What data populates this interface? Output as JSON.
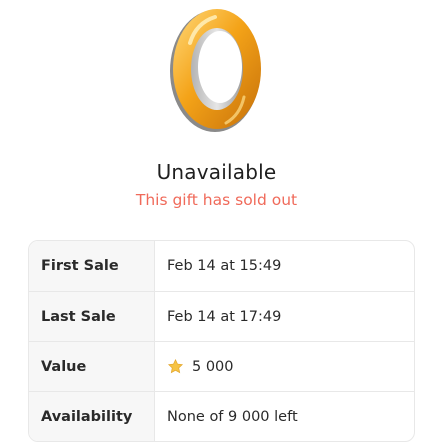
{
  "gift": {
    "image_icon": "gold-ring-icon",
    "status_title": "Unavailable",
    "status_subtitle": "This gift has sold out"
  },
  "details": {
    "rows": [
      {
        "label": "First Sale",
        "value": "Feb 14 at 15:49"
      },
      {
        "label": "Last Sale",
        "value": "Feb 14 at 17:49"
      },
      {
        "label": "Value",
        "value": "5 000",
        "icon": "star-icon"
      },
      {
        "label": "Availability",
        "value": "None of 9 000 left"
      }
    ]
  },
  "colors": {
    "accent_error": "#f06a5a",
    "ring_gold": "#f4a318",
    "star_gold": "#f6c343"
  }
}
